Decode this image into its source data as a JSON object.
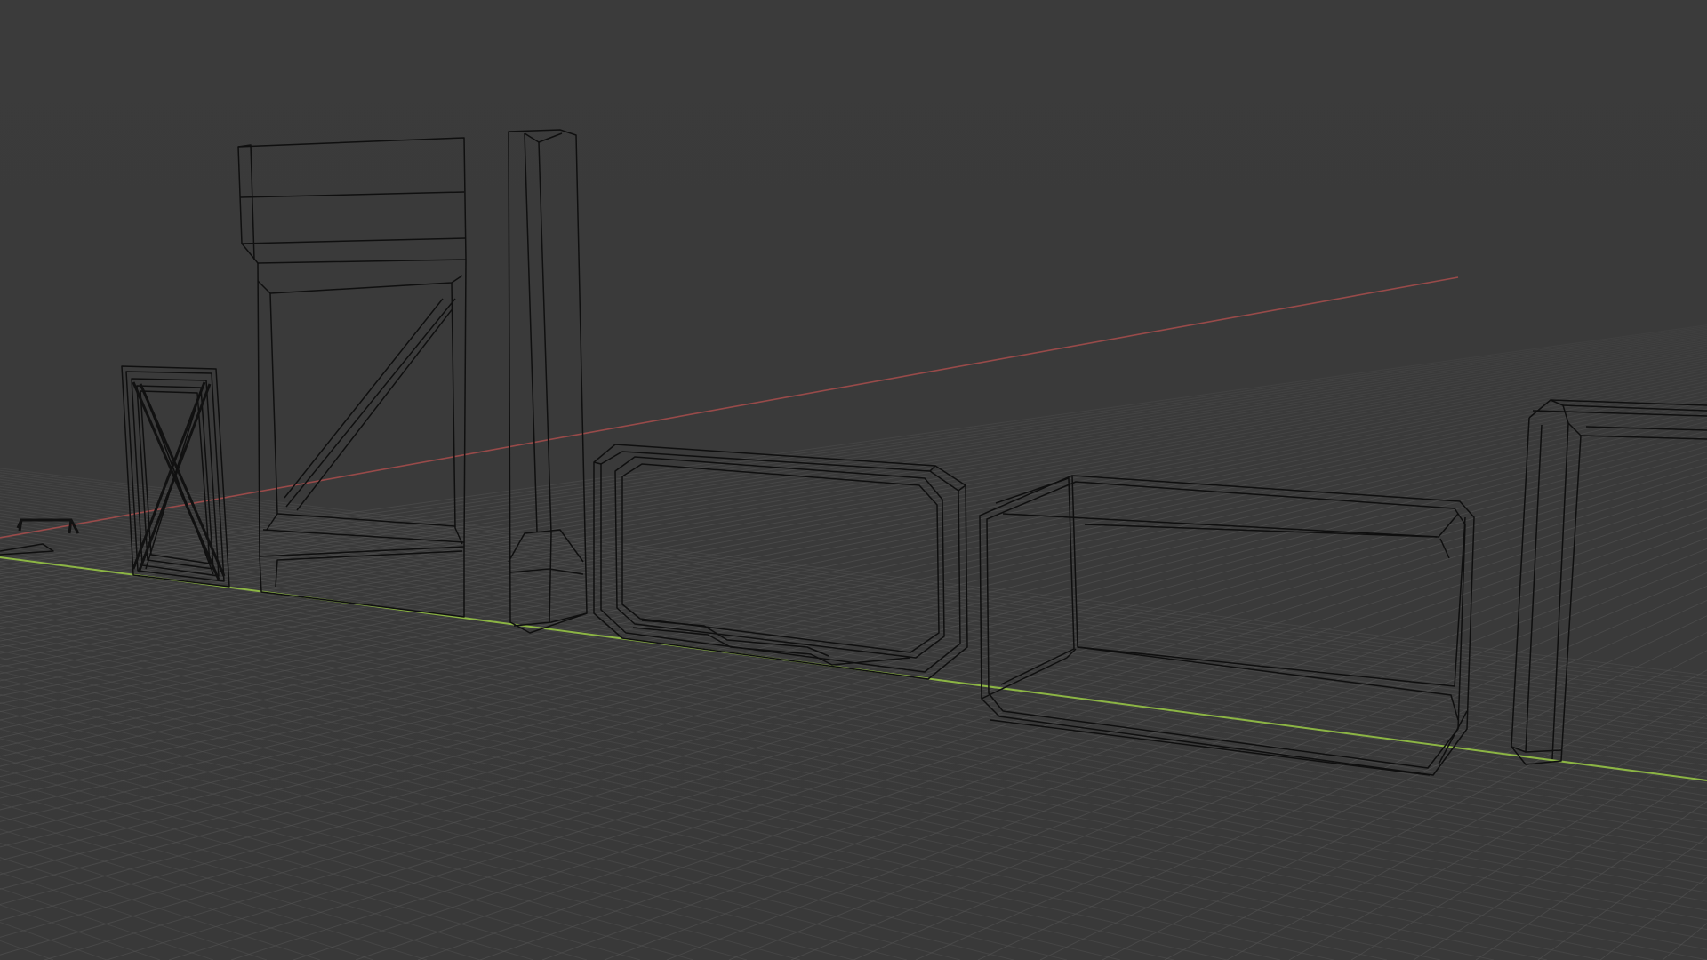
{
  "viewport": {
    "background_color": "#3a3a3a",
    "grid_color": "#555555",
    "x_axis_color": "#b8504f",
    "y_axis_color": "#8cb544",
    "wire_color": "#0f0f0f",
    "shading": "wireframe"
  },
  "objects": [
    {
      "name": "handle-prop"
    },
    {
      "name": "x-brace-crate"
    },
    {
      "name": "tall-door-frame"
    },
    {
      "name": "pillar"
    },
    {
      "name": "beveled-frame-panel"
    },
    {
      "name": "open-box-frame"
    },
    {
      "name": "corner-frame"
    }
  ]
}
